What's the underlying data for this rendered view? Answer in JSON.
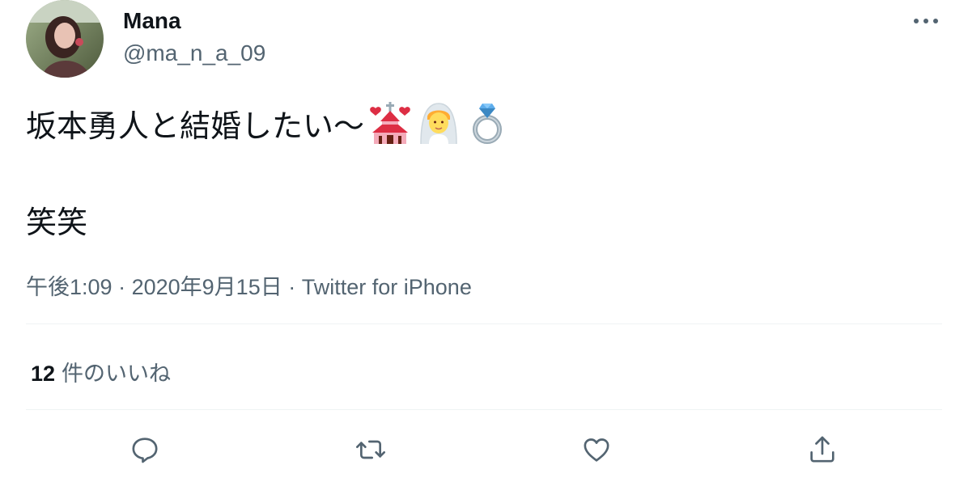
{
  "user": {
    "name": "Mana",
    "handle": "@ma_n_a_09"
  },
  "tweet": {
    "line1": "坂本勇人と結婚したい〜",
    "line1_emojis": [
      "wedding-icon",
      "bride-with-veil-icon",
      "ring-icon"
    ],
    "line2": "笑笑"
  },
  "meta": {
    "time": "午後1:09",
    "separator": "·",
    "date": "2020年9月15日",
    "source": "Twitter for iPhone"
  },
  "stats": {
    "likes_count": "12",
    "likes_label": "件のいいね"
  },
  "actions": [
    "reply-icon",
    "retweet-icon",
    "like-icon",
    "share-icon"
  ],
  "colors": {
    "text": "#0f1419",
    "secondary": "#536471",
    "divider": "#eff3f4"
  }
}
